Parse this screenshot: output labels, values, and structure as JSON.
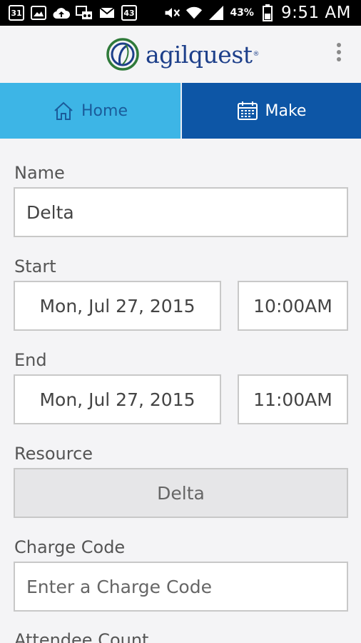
{
  "status_bar": {
    "notification_icons": [
      "calendar-icon",
      "photo-icon",
      "cloud-upload-icon",
      "voicemail-icon",
      "email-icon",
      "app-icon"
    ],
    "calendar_day": "31",
    "app_badge": "43",
    "battery": "43%",
    "time": "9:51 AM"
  },
  "header": {
    "logo_text": "agilquest",
    "logo_reg": "®"
  },
  "tabs": [
    {
      "label": "Home",
      "icon": "home-icon"
    },
    {
      "label": "Make",
      "icon": "calendar-grid-icon"
    }
  ],
  "form": {
    "name_label": "Name",
    "name_value": "Delta",
    "start_label": "Start",
    "start_date": "Mon, Jul 27, 2015",
    "start_time": "10:00AM",
    "end_label": "End",
    "end_date": "Mon, Jul 27, 2015",
    "end_time": "11:00AM",
    "resource_label": "Resource",
    "resource_value": "Delta",
    "charge_code_label": "Charge Code",
    "charge_code_placeholder": "Enter a Charge Code",
    "attendee_count_label": "Attendee Count"
  },
  "colors": {
    "tab_home_bg": "#3db5e6",
    "tab_make_bg": "#0d56a6",
    "brand_blue": "#1d3f8a",
    "brand_green": "#2f7a3a"
  }
}
